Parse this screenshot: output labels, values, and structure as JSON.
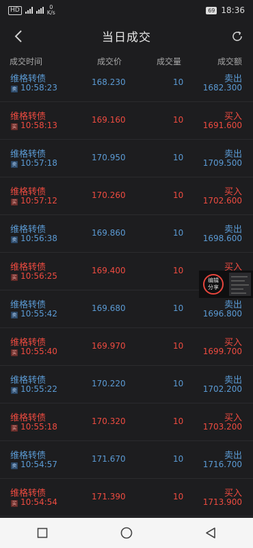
{
  "status_bar": {
    "hd": "HD",
    "network_speed_value": "0",
    "network_speed_unit": "K/s",
    "battery": "69",
    "time": "18:36"
  },
  "header": {
    "title": "当日成交"
  },
  "columns": {
    "time": "成交时间",
    "price": "成交价",
    "volume": "成交量",
    "amount": "成交额"
  },
  "rows": [
    {
      "name": "维格转债",
      "badge": "卖",
      "time": "10:58:23",
      "price": "168.230",
      "volume": "10",
      "direction": "卖出",
      "amount": "1682.300",
      "side": "sell"
    },
    {
      "name": "维格转债",
      "badge": "买",
      "time": "10:58:13",
      "price": "169.160",
      "volume": "10",
      "direction": "买入",
      "amount": "1691.600",
      "side": "buy"
    },
    {
      "name": "维格转债",
      "badge": "卖",
      "time": "10:57:18",
      "price": "170.950",
      "volume": "10",
      "direction": "卖出",
      "amount": "1709.500",
      "side": "sell"
    },
    {
      "name": "维格转债",
      "badge": "买",
      "time": "10:57:12",
      "price": "170.260",
      "volume": "10",
      "direction": "买入",
      "amount": "1702.600",
      "side": "buy"
    },
    {
      "name": "维格转债",
      "badge": "卖",
      "time": "10:56:38",
      "price": "169.860",
      "volume": "10",
      "direction": "卖出",
      "amount": "1698.600",
      "side": "sell"
    },
    {
      "name": "维格转债",
      "badge": "买",
      "time": "10:56:25",
      "price": "169.400",
      "volume": "10",
      "direction": "买入",
      "amount": "",
      "side": "buy"
    },
    {
      "name": "维格转债",
      "badge": "卖",
      "time": "10:55:42",
      "price": "169.680",
      "volume": "10",
      "direction": "卖出",
      "amount": "1696.800",
      "side": "sell"
    },
    {
      "name": "维格转债",
      "badge": "买",
      "time": "10:55:40",
      "price": "169.970",
      "volume": "10",
      "direction": "买入",
      "amount": "1699.700",
      "side": "buy"
    },
    {
      "name": "维格转债",
      "badge": "卖",
      "time": "10:55:22",
      "price": "170.220",
      "volume": "10",
      "direction": "卖出",
      "amount": "1702.200",
      "side": "sell"
    },
    {
      "name": "维格转债",
      "badge": "买",
      "time": "10:55:18",
      "price": "170.320",
      "volume": "10",
      "direction": "买入",
      "amount": "1703.200",
      "side": "buy"
    },
    {
      "name": "维格转债",
      "badge": "卖",
      "time": "10:54:57",
      "price": "171.670",
      "volume": "10",
      "direction": "卖出",
      "amount": "1716.700",
      "side": "sell"
    },
    {
      "name": "维格转债",
      "badge": "买",
      "time": "10:54:54",
      "price": "171.390",
      "volume": "10",
      "direction": "买入",
      "amount": "1713.900",
      "side": "buy"
    }
  ],
  "floating_widget": {
    "line1": "编辑",
    "line2": "分享"
  },
  "colors": {
    "background": "#1d1d1f",
    "sell": "#5b9bd5",
    "buy": "#ef4b40"
  },
  "icons": {
    "back": "chevron-left-icon",
    "refresh": "refresh-icon",
    "nav_recent": "square-icon",
    "nav_home": "circle-icon",
    "nav_back": "triangle-back-icon"
  }
}
